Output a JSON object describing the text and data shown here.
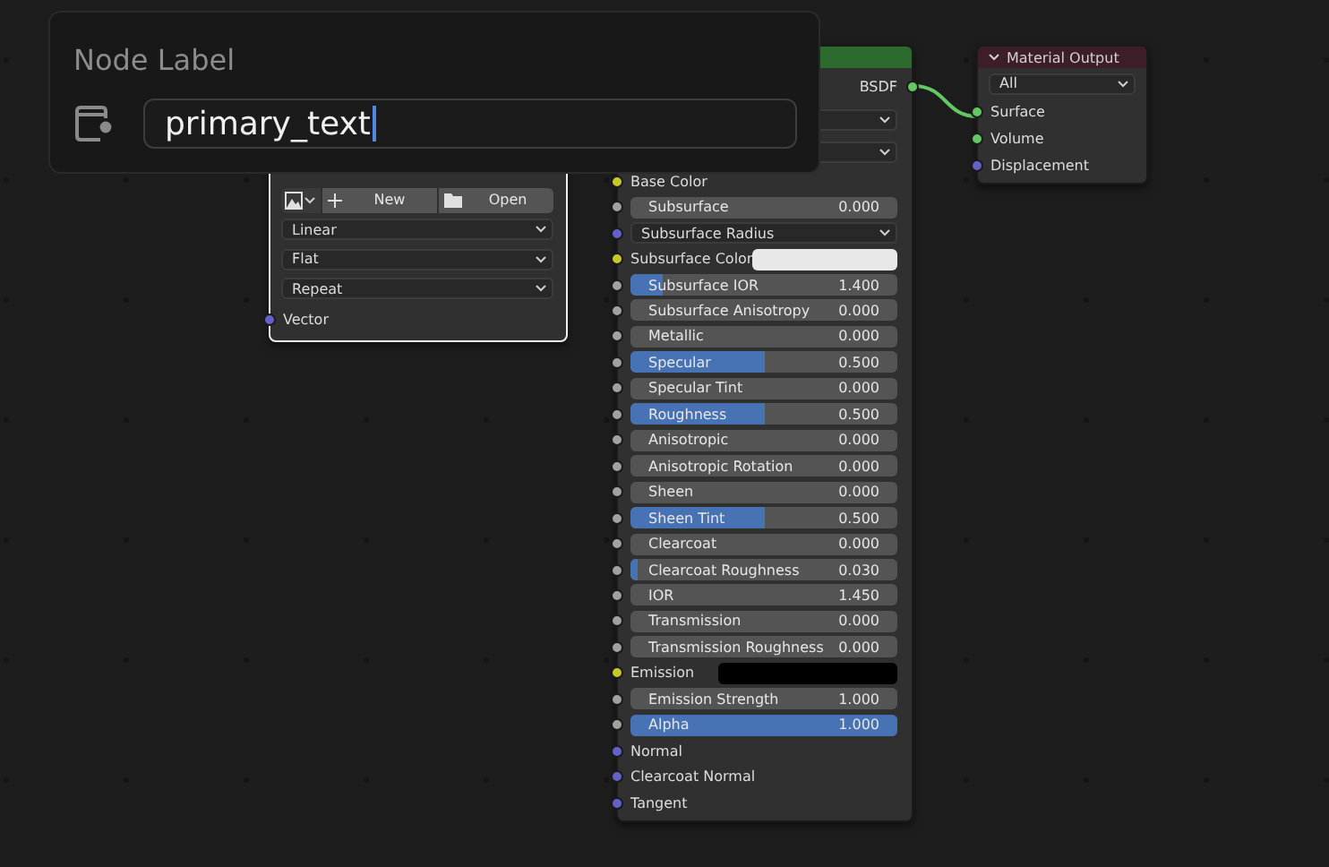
{
  "popup": {
    "title": "Node Label",
    "field": {
      "value": "primary_text",
      "focused": true
    }
  },
  "image_texture_node": {
    "selected": true,
    "buttons": [
      {
        "kind": "new",
        "label": "New"
      },
      {
        "kind": "open",
        "label": "Open"
      }
    ],
    "dropdowns": [
      "Linear",
      "Flat",
      "Repeat"
    ],
    "inputs": [
      {
        "label": "Vector",
        "color": "#6363c7"
      }
    ]
  },
  "bsdf_node": {
    "output": {
      "label": "BSDF",
      "color": "#63c763"
    },
    "inputs": [
      {
        "kind": "socket",
        "label": "Base Color",
        "color": "#c7c729"
      },
      {
        "kind": "slider",
        "label": "Subsurface",
        "value": "0.000",
        "level": 0,
        "color": "#a1a1a1"
      },
      {
        "kind": "dropdown",
        "label": "Subsurface Radius",
        "color": "#6363c7"
      },
      {
        "kind": "swatch",
        "label": "Subsurface Color",
        "swatch": {
          "color": "#e8e8e8"
        },
        "color": "#c7c729"
      },
      {
        "kind": "slider",
        "label": "Subsurface IOR",
        "value": "1.400",
        "level": 0.12,
        "color": "#a1a1a1"
      },
      {
        "kind": "slider",
        "label": "Subsurface Anisotropy",
        "value": "0.000",
        "level": 0,
        "color": "#a1a1a1"
      },
      {
        "kind": "slider",
        "label": "Metallic",
        "value": "0.000",
        "level": 0,
        "color": "#a1a1a1"
      },
      {
        "kind": "slider",
        "label": "Specular",
        "value": "0.500",
        "level": 0.5,
        "color": "#a1a1a1"
      },
      {
        "kind": "slider",
        "label": "Specular Tint",
        "value": "0.000",
        "level": 0,
        "color": "#a1a1a1"
      },
      {
        "kind": "slider",
        "label": "Roughness",
        "value": "0.500",
        "level": 0.5,
        "color": "#a1a1a1"
      },
      {
        "kind": "slider",
        "label": "Anisotropic",
        "value": "0.000",
        "level": 0,
        "color": "#a1a1a1"
      },
      {
        "kind": "slider",
        "label": "Anisotropic Rotation",
        "value": "0.000",
        "level": 0,
        "color": "#a1a1a1"
      },
      {
        "kind": "slider",
        "label": "Sheen",
        "value": "0.000",
        "level": 0,
        "color": "#a1a1a1"
      },
      {
        "kind": "slider",
        "label": "Sheen Tint",
        "value": "0.500",
        "level": 0.5,
        "color": "#a1a1a1"
      },
      {
        "kind": "slider",
        "label": "Clearcoat",
        "value": "0.000",
        "level": 0,
        "color": "#a1a1a1"
      },
      {
        "kind": "slider",
        "label": "Clearcoat Roughness",
        "value": "0.030",
        "level": 0.03,
        "color": "#a1a1a1"
      },
      {
        "kind": "slider",
        "label": "IOR",
        "value": "1.450",
        "level": 0,
        "color": "#a1a1a1"
      },
      {
        "kind": "slider",
        "label": "Transmission",
        "value": "0.000",
        "level": 0,
        "color": "#a1a1a1"
      },
      {
        "kind": "slider",
        "label": "Transmission Roughness",
        "value": "0.000",
        "level": 0,
        "color": "#a1a1a1"
      },
      {
        "kind": "swatch",
        "label": "Emission",
        "swatch": {
          "color": "#000000"
        },
        "color": "#c7c729"
      },
      {
        "kind": "slider",
        "label": "Emission Strength",
        "value": "1.000",
        "level": 0,
        "color": "#a1a1a1"
      },
      {
        "kind": "slider",
        "label": "Alpha",
        "value": "1.000",
        "level": 1,
        "color": "#a1a1a1"
      },
      {
        "kind": "socket",
        "label": "Normal",
        "color": "#6363c7"
      },
      {
        "kind": "socket",
        "label": "Clearcoat Normal",
        "color": "#6363c7"
      },
      {
        "kind": "socket",
        "label": "Tangent",
        "color": "#6363c7"
      }
    ]
  },
  "material_output_node": {
    "title": "Material Output",
    "expanded": true,
    "target": "All",
    "inputs": [
      {
        "label": "Surface",
        "color": "#63c763"
      },
      {
        "label": "Volume",
        "color": "#63c763"
      },
      {
        "label": "Displacement",
        "color": "#6363c7"
      }
    ]
  }
}
